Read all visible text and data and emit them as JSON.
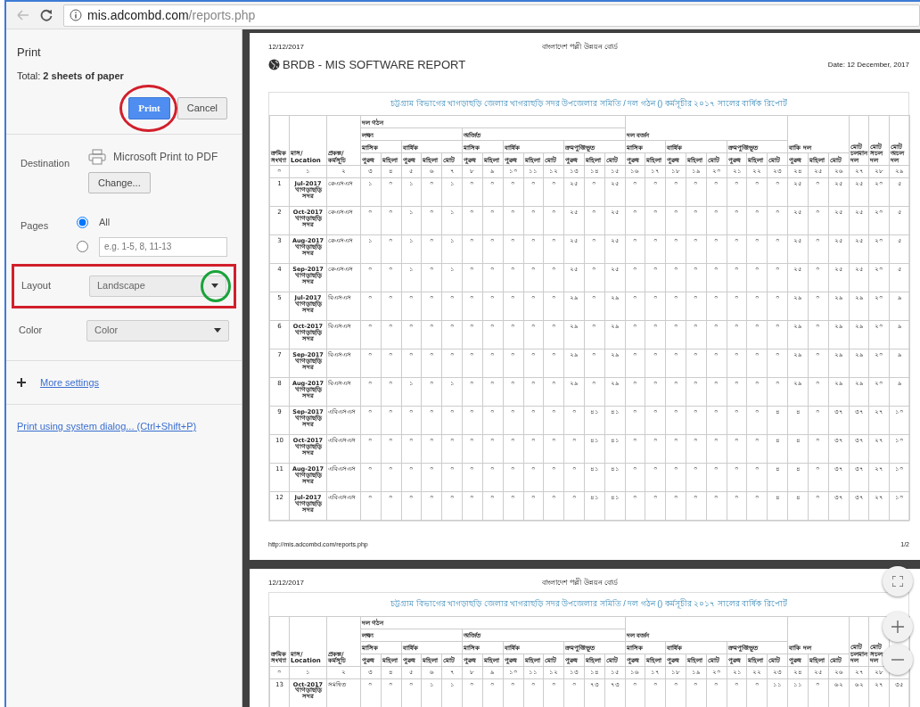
{
  "address_bar": {
    "host": "mis.adcombd.com",
    "path": "/reports.php"
  },
  "print_panel": {
    "title": "Print",
    "total_label": "Total:",
    "total_value": "2 sheets of paper",
    "buttons": [
      {
        "label": "Print",
        "kind": "primary",
        "circled": true
      },
      {
        "label": "Cancel",
        "kind": "secondary",
        "circled": false
      }
    ],
    "destination": {
      "label": "Destination",
      "printer": "Microsoft Print to PDF",
      "change_button": "Change..."
    },
    "pages": {
      "label": "Pages",
      "options": [
        {
          "label": "All",
          "selected": true
        },
        {
          "placeholder": "e.g. 1-5, 8, 11-13",
          "selected": false
        }
      ]
    },
    "settings": [
      {
        "label": "Layout",
        "value": "Landscape",
        "boxed": true,
        "arrow_circled": true
      },
      {
        "label": "Color",
        "value": "Color",
        "boxed": false,
        "arrow_circled": false
      }
    ],
    "more_settings": "More settings",
    "system_dialog": "Print using system dialog... (Ctrl+Shift+P)"
  },
  "preview": {
    "pages": [
      {
        "date": "12/12/2017",
        "org": "বাংলাদেশ পল্লী উন্নয়ন বোর্ড",
        "report_title": "BRDB - MIS SOFTWARE REPORT",
        "report_date": "Date: 12 December, 2017",
        "table_title": "চট্টগ্রাম বিভাগের খাগড়াছড়ি জেলার খাগরাছড়ি সদর উপজেলার সমিতি / দল গঠন () কর্মসূচীর ২০১৭ সালের বার্ষিক রিপোর্ট",
        "header": [
          {
            "label": "ক্রমিক সংখ্যা"
          },
          {
            "label": "মাস/ Location"
          },
          {
            "label": "প্রকল্প/ কর্মসূচি"
          },
          {
            "label": "দল গঠন",
            "children": [
              {
                "label": "লক্ষ্য",
                "children": [
                  {
                    "label": "মাসিক",
                    "children": [
                      {
                        "label": "পুরুষ"
                      },
                      {
                        "label": "মহিলা"
                      }
                    ]
                  },
                  {
                    "label": "বার্ষিক",
                    "children": [
                      {
                        "label": "পুরুষ"
                      },
                      {
                        "label": "মহিলা"
                      },
                      {
                        "label": "মোট"
                      }
                    ]
                  }
                ]
              },
              {
                "label": "অর্জিত",
                "children": [
                  {
                    "label": "মাসিক",
                    "children": [
                      {
                        "label": "পুরুষ"
                      },
                      {
                        "label": "মহিলা"
                      }
                    ]
                  },
                  {
                    "label": "বার্ষিক",
                    "children": [
                      {
                        "label": "পুরুষ"
                      },
                      {
                        "label": "মহিলা"
                      },
                      {
                        "label": "মোট"
                      }
                    ]
                  },
                  {
                    "label": "ক্রমপুঞ্জিভূত",
                    "children": [
                      {
                        "label": "পুরুষ"
                      },
                      {
                        "label": "মহিলা"
                      },
                      {
                        "label": "মোট"
                      }
                    ]
                  }
                ]
              }
            ]
          },
          {
            "label": "দল বর্জন",
            "children": [
              {
                "label": "মাসিক",
                "children": [
                  {
                    "label": "পুরুষ"
                  },
                  {
                    "label": "মহিলা"
                  }
                ]
              },
              {
                "label": "বার্ষিক",
                "children": [
                  {
                    "label": "পুরুষ"
                  },
                  {
                    "label": "মহিলা"
                  },
                  {
                    "label": "মোট"
                  }
                ]
              },
              {
                "label": "ক্রমপুঞ্জিভূত",
                "children": [
                  {
                    "label": "পুরুষ"
                  },
                  {
                    "label": "মহিলা"
                  },
                  {
                    "label": "মোট"
                  }
                ]
              }
            ]
          },
          {
            "label": "বাকি দল",
            "children": [
              {
                "label": "পুরুষ"
              },
              {
                "label": "মহিলা"
              },
              {
                "label": "মোট"
              }
            ]
          },
          {
            "label": "মোট চলমান দল"
          },
          {
            "label": "মোট সচল দল"
          },
          {
            "label": "মোট অচল দল"
          }
        ],
        "index_row": [
          "০",
          "১",
          "২",
          "৩",
          "৪",
          "৫",
          "৬",
          "৭",
          "৮",
          "৯",
          "১০",
          "১১",
          "১২",
          "১৩",
          "১৪",
          "১৫",
          "১৬",
          "১৭",
          "১৮",
          "১৯",
          "২০",
          "২১",
          "২২",
          "২৩",
          "২৪",
          "২৫",
          "২৬",
          "২৭",
          "২৮",
          "২৯"
        ],
        "rows": [
          {
            "serial": "1",
            "month": "Jul-2017",
            "location": "খাগড়াছড়ি সদর",
            "program": "কেএসএস",
            "values": [
              "১",
              "০",
              "১",
              "০",
              "১",
              "০",
              "০",
              "০",
              "০",
              "০",
              "২৫",
              "০",
              "২৫",
              "০",
              "০",
              "০",
              "০",
              "০",
              "০",
              "০",
              "০",
              "২৫",
              "০",
              "২৫",
              "২৫",
              "২০",
              "৫"
            ]
          },
          {
            "serial": "2",
            "month": "Oct-2017",
            "location": "খাগড়াছড়ি সদর",
            "program": "কেএসএস",
            "values": [
              "০",
              "০",
              "১",
              "০",
              "১",
              "০",
              "০",
              "০",
              "০",
              "০",
              "২৫",
              "০",
              "২৫",
              "০",
              "০",
              "০",
              "০",
              "০",
              "০",
              "০",
              "০",
              "২৫",
              "০",
              "২৫",
              "২৫",
              "২০",
              "৫"
            ]
          },
          {
            "serial": "3",
            "month": "Aug-2017",
            "location": "খাগড়াছড়ি সদর",
            "program": "কেএসএস",
            "values": [
              "১",
              "০",
              "১",
              "০",
              "১",
              "০",
              "০",
              "০",
              "০",
              "০",
              "২৫",
              "০",
              "২৫",
              "০",
              "০",
              "০",
              "০",
              "০",
              "০",
              "০",
              "০",
              "২৫",
              "০",
              "২৫",
              "২৫",
              "২০",
              "৫"
            ]
          },
          {
            "serial": "4",
            "month": "Sep-2017",
            "location": "খাগড়াছড়ি সদর",
            "program": "কেএসএস",
            "values": [
              "০",
              "০",
              "১",
              "০",
              "১",
              "০",
              "০",
              "০",
              "০",
              "০",
              "২৫",
              "০",
              "২৫",
              "০",
              "০",
              "০",
              "০",
              "০",
              "০",
              "০",
              "০",
              "২৫",
              "০",
              "২৫",
              "২৫",
              "২০",
              "৫"
            ]
          },
          {
            "serial": "5",
            "month": "Jul-2017",
            "location": "খাগড়াছড়ি সদর",
            "program": "বিএসএস",
            "values": [
              "০",
              "০",
              "০",
              "০",
              "০",
              "০",
              "০",
              "০",
              "০",
              "০",
              "২৯",
              "০",
              "২৯",
              "০",
              "০",
              "০",
              "০",
              "০",
              "০",
              "০",
              "০",
              "২৯",
              "০",
              "২৯",
              "২৯",
              "২০",
              "৯"
            ]
          },
          {
            "serial": "6",
            "month": "Oct-2017",
            "location": "খাগড়াছড়ি সদর",
            "program": "বিএসএস",
            "values": [
              "০",
              "০",
              "০",
              "০",
              "০",
              "০",
              "০",
              "০",
              "০",
              "০",
              "২৯",
              "০",
              "২৯",
              "০",
              "০",
              "০",
              "০",
              "০",
              "০",
              "০",
              "০",
              "২৯",
              "০",
              "২৯",
              "২৯",
              "২০",
              "৯"
            ]
          },
          {
            "serial": "7",
            "month": "Sep-2017",
            "location": "খাগড়াছড়ি সদর",
            "program": "বিএসএস",
            "values": [
              "০",
              "০",
              "০",
              "০",
              "০",
              "০",
              "০",
              "০",
              "০",
              "০",
              "২৯",
              "০",
              "২৯",
              "০",
              "০",
              "০",
              "০",
              "০",
              "০",
              "০",
              "০",
              "২৯",
              "০",
              "২৯",
              "২৯",
              "২০",
              "৯"
            ]
          },
          {
            "serial": "8",
            "month": "Aug-2017",
            "location": "খাগড়াছড়ি সদর",
            "program": "বিএসএস",
            "values": [
              "০",
              "০",
              "১",
              "০",
              "১",
              "০",
              "০",
              "০",
              "০",
              "০",
              "২৯",
              "০",
              "২৯",
              "০",
              "০",
              "০",
              "০",
              "০",
              "০",
              "০",
              "০",
              "২৯",
              "০",
              "২৯",
              "২৯",
              "২০",
              "৯"
            ]
          },
          {
            "serial": "9",
            "month": "Sep-2017",
            "location": "খাগড়াছড়ি সদর",
            "program": "এবিএসএস",
            "values": [
              "০",
              "০",
              "০",
              "০",
              "০",
              "০",
              "০",
              "০",
              "০",
              "০",
              "০",
              "৪১",
              "৪১",
              "০",
              "০",
              "০",
              "০",
              "০",
              "০",
              "০",
              "৪",
              "৪",
              "০",
              "৩৭",
              "৩৭",
              "২৭",
              "১০"
            ]
          },
          {
            "serial": "10",
            "month": "Oct-2017",
            "location": "খাগড়াছড়ি সদর",
            "program": "এবিএসএস",
            "values": [
              "০",
              "০",
              "০",
              "০",
              "০",
              "০",
              "০",
              "০",
              "০",
              "০",
              "০",
              "৪১",
              "৪১",
              "০",
              "০",
              "০",
              "০",
              "০",
              "০",
              "০",
              "৪",
              "৪",
              "০",
              "৩৭",
              "৩৭",
              "২৭",
              "১০"
            ]
          },
          {
            "serial": "11",
            "month": "Aug-2017",
            "location": "খাগড়াছড়ি সদর",
            "program": "এবিএসএস",
            "values": [
              "০",
              "০",
              "০",
              "০",
              "০",
              "০",
              "০",
              "০",
              "০",
              "০",
              "০",
              "৪১",
              "৪১",
              "০",
              "০",
              "০",
              "০",
              "০",
              "০",
              "০",
              "৪",
              "৪",
              "০",
              "৩৭",
              "৩৭",
              "২৭",
              "১০"
            ]
          },
          {
            "serial": "12",
            "month": "Jul-2017",
            "location": "খাগড়াছড়ি সদর",
            "program": "এবিএসএস",
            "values": [
              "০",
              "০",
              "০",
              "০",
              "০",
              "০",
              "০",
              "০",
              "০",
              "০",
              "০",
              "৪১",
              "৪১",
              "০",
              "০",
              "০",
              "০",
              "০",
              "০",
              "০",
              "৪",
              "৪",
              "০",
              "৩৭",
              "৩৭",
              "২৭",
              "১০"
            ]
          }
        ],
        "footer_url": "http://mis.adcombd.com/reports.php",
        "page_number": "1/2"
      },
      {
        "date": "12/12/2017",
        "org": "বাংলাদেশ পল্লী উন্নয়ন বোর্ড",
        "table_title": "চট্টগ্রাম বিভাগের খাগড়াছড়ি জেলার খাগরাছড়ি সদর উপজেলার সমিতি / দল গঠন () কর্মসূচীর ২০১৭ সালের বার্ষিক রিপোর্ট",
        "header": [
          {
            "label": "ক্রমিক সংখ্যা"
          },
          {
            "label": "মাস/ Location"
          },
          {
            "label": "প্রকল্প/ কর্মসূচি"
          },
          {
            "label": "দল গঠন",
            "children": [
              {
                "label": "লক্ষ্য",
                "children": [
                  {
                    "label": "মাসিক",
                    "children": [
                      {
                        "label": "পুরুষ"
                      },
                      {
                        "label": "মহিলা"
                      }
                    ]
                  },
                  {
                    "label": "বার্ষিক",
                    "children": [
                      {
                        "label": "পুরুষ"
                      },
                      {
                        "label": "মহিলা"
                      },
                      {
                        "label": "মোট"
                      }
                    ]
                  }
                ]
              },
              {
                "label": "অর্জিত",
                "children": [
                  {
                    "label": "মাসিক",
                    "children": [
                      {
                        "label": "পুরুষ"
                      },
                      {
                        "label": "মহিলা"
                      }
                    ]
                  },
                  {
                    "label": "বার্ষিক",
                    "children": [
                      {
                        "label": "পুরুষ"
                      },
                      {
                        "label": "মহিলা"
                      },
                      {
                        "label": "মোট"
                      }
                    ]
                  },
                  {
                    "label": "ক্রমপুঞ্জিভূত",
                    "children": [
                      {
                        "label": "পুরুষ"
                      },
                      {
                        "label": "মহিলা"
                      },
                      {
                        "label": "মোট"
                      }
                    ]
                  }
                ]
              }
            ]
          },
          {
            "label": "দল বর্জন",
            "children": [
              {
                "label": "মাসিক",
                "children": [
                  {
                    "label": "পুরুষ"
                  },
                  {
                    "label": "মহিলা"
                  }
                ]
              },
              {
                "label": "বার্ষিক",
                "children": [
                  {
                    "label": "পুরুষ"
                  },
                  {
                    "label": "মহিলা"
                  },
                  {
                    "label": "মোট"
                  }
                ]
              },
              {
                "label": "ক্রমপুঞ্জিভূত",
                "children": [
                  {
                    "label": "পুরুষ"
                  },
                  {
                    "label": "মহিলা"
                  },
                  {
                    "label": "মোট"
                  }
                ]
              }
            ]
          },
          {
            "label": "বাকি দল",
            "children": [
              {
                "label": "পুরুষ"
              },
              {
                "label": "মহিলা"
              },
              {
                "label": "মোট"
              }
            ]
          },
          {
            "label": "মোট চলমান দল"
          },
          {
            "label": "মোট সচল দল"
          }
        ],
        "index_row": [
          "০",
          "১",
          "২",
          "৩",
          "৪",
          "৫",
          "৬",
          "৭",
          "৮",
          "৯",
          "১০",
          "১১",
          "১২",
          "১৩",
          "১৪",
          "১৫",
          "১৬",
          "১৭",
          "১৮",
          "১৯",
          "২০",
          "২১",
          "২২",
          "২৩",
          "২৪",
          "২৫",
          "২৬",
          "২৭",
          "২৮"
        ],
        "rows": [
          {
            "serial": "13",
            "month": "Oct-2017",
            "location": "খাগড়াছড়ি সদর",
            "program": "সমন্বিত",
            "values": [
              "০",
              "০",
              "০",
              "১",
              "১",
              "০",
              "০",
              "০",
              "০",
              "০",
              "০",
              "৭৩",
              "৭৩",
              "০",
              "০",
              "০",
              "০",
              "০",
              "০",
              "০",
              "১১",
              "১১",
              "০",
              "৬২",
              "৬২",
              "২৭",
              "৩৫"
            ]
          }
        ]
      }
    ]
  }
}
